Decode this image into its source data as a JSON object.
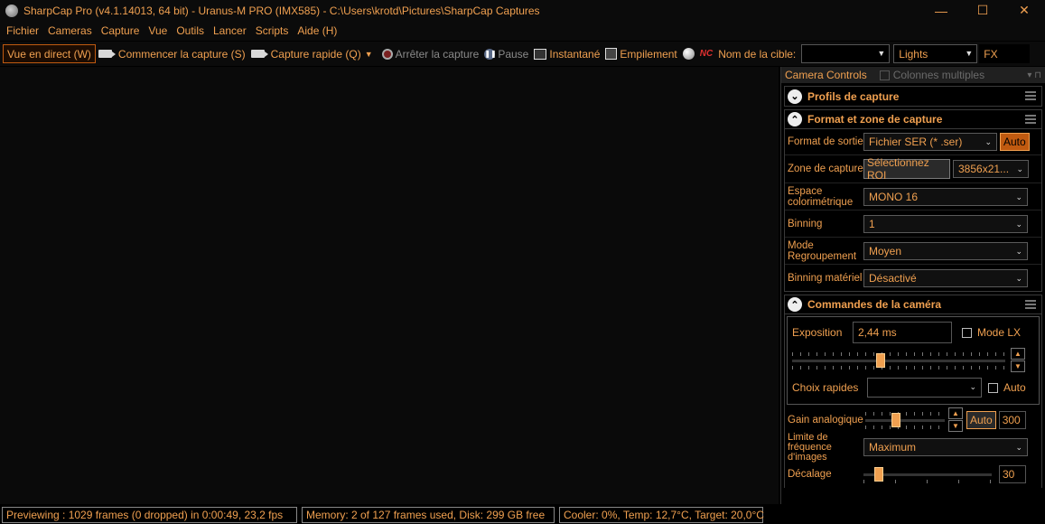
{
  "window": {
    "title": "SharpCap Pro (v4.1.14013, 64 bit) - Uranus-M PRO (IMX585) - C:\\Users\\krotd\\Pictures\\SharpCap Captures",
    "minimize_glyph": "—",
    "maximize_glyph": "☐",
    "close_glyph": "✕"
  },
  "menu": [
    "Fichier",
    "Cameras",
    "Capture",
    "Vue",
    "Outils",
    "Lancer",
    "Scripts",
    "Aide (H)"
  ],
  "toolbar": {
    "live_view": "Vue en direct (W)",
    "start_capture": "Commencer la capture (S)",
    "quick_capture": "Capture rapide (Q)",
    "stop_capture": "Arrêter la capture",
    "pause": "Pause",
    "snapshot": "Instantané",
    "stacking": "Empilement",
    "nc_badge": "NC",
    "target_label": "Nom de la cible:",
    "target_value": "",
    "frame_type": "Lights",
    "fx": "FX"
  },
  "panel": {
    "title": "Camera Controls",
    "multi_columns": "Colonnes multiples",
    "sections": {
      "profiles": {
        "title": "Profils de capture"
      },
      "format": {
        "title": "Format et zone de capture",
        "output_format_label": "Format de sortie",
        "output_format_value": "Fichier SER (* .ser)",
        "auto_label": "Auto",
        "capture_area_label": "Zone de capture",
        "select_roi_label": "Sélectionnez ROI",
        "resolution_value": "3856x21...",
        "colorspace_label": "Espace colorimétrique",
        "colorspace_value": "MONO 16",
        "binning_label": "Binning",
        "binning_value": "1",
        "bin_mode_label": "Mode Regroupement",
        "bin_mode_value": "Moyen",
        "hw_binning_label": "Binning matériel",
        "hw_binning_value": "Désactivé"
      },
      "camera": {
        "title": "Commandes de la caméra",
        "exposure_label": "Exposition",
        "exposure_value": "2,44 ms",
        "lx_mode_label": "Mode LX",
        "quick_choice_label": "Choix rapides",
        "quick_choice_value": "",
        "quick_auto_label": "Auto",
        "gain_label": "Gain analogique",
        "gain_auto_label": "Auto",
        "gain_value": "300",
        "frame_limit_label": "Limite de fréquence d'images",
        "frame_limit_value": "Maximum",
        "offset_label": "Décalage",
        "offset_value": "30"
      }
    }
  },
  "status": {
    "previewing": "Previewing : 1029 frames (0 dropped) in 0:00:49, 23,2 fps",
    "memory": "Memory: 2 of 127 frames used, Disk: 299 GB free",
    "cooler": "Cooler: 0%, Temp: 12,7°C, Target: 20,0°C"
  }
}
